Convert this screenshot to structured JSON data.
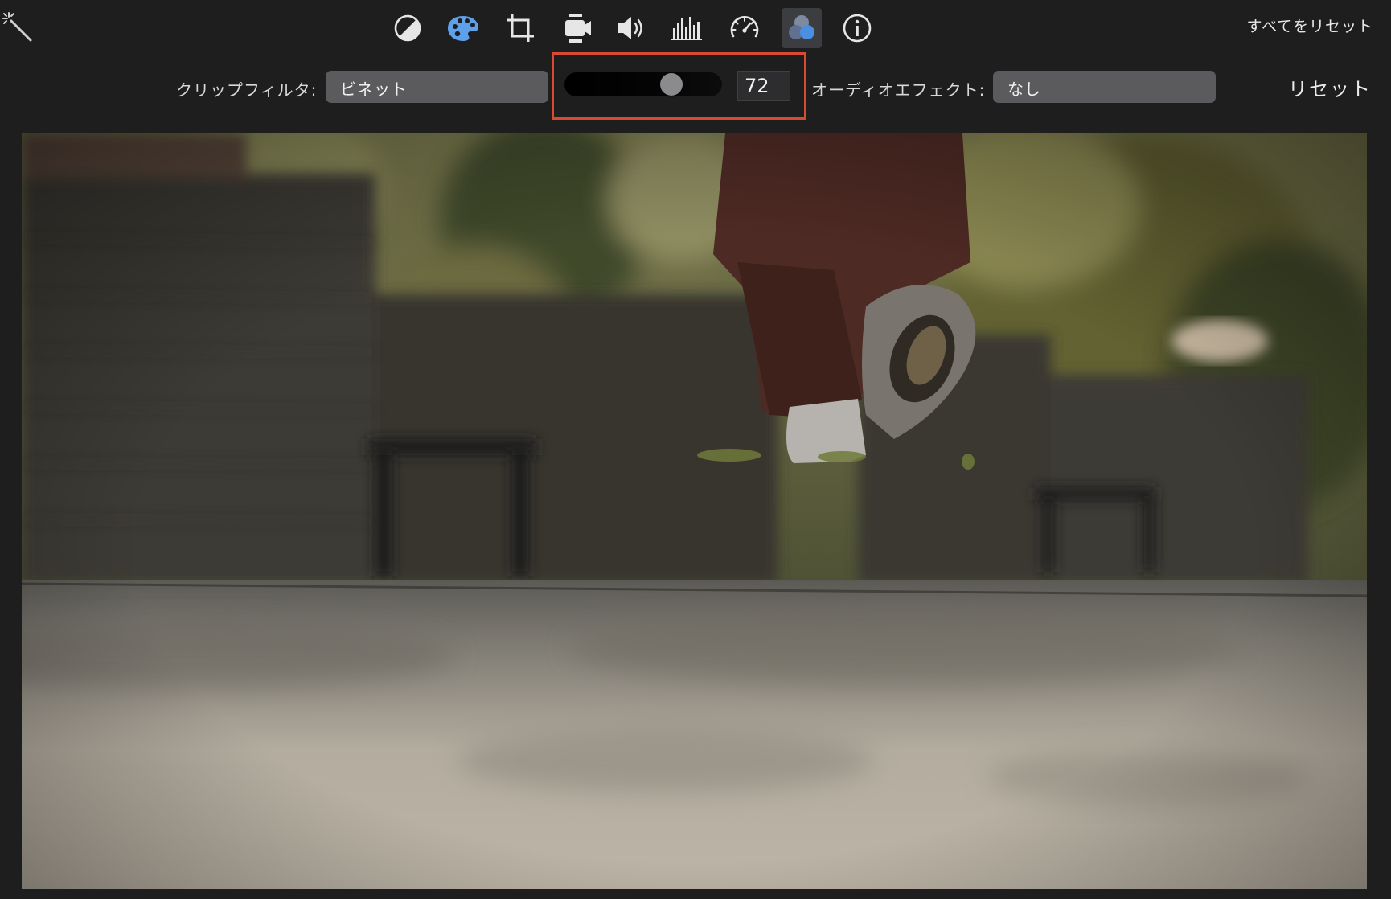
{
  "toolbar": {
    "reset_all_label": "すべてをリセット",
    "tools": [
      {
        "icon": "color-balance-icon"
      },
      {
        "icon": "color-palette-icon"
      },
      {
        "icon": "crop-icon"
      },
      {
        "icon": "stabilization-icon"
      },
      {
        "icon": "volume-icon"
      },
      {
        "icon": "equalizer-icon"
      },
      {
        "icon": "speed-icon"
      },
      {
        "icon": "clip-filter-icon",
        "active": true
      },
      {
        "icon": "info-icon"
      }
    ]
  },
  "filters": {
    "clip_filter_label": "クリップフィルタ:",
    "clip_filter_value": "ビネット",
    "intensity_value": "72",
    "intensity_fraction": 0.72,
    "audio_effect_label": "オーディオエフェクト:",
    "audio_effect_value": "なし",
    "reset_label": "リセット"
  },
  "colors": {
    "background": "#1e1e1f",
    "highlight_border": "#d94a33",
    "active_tool_bg": "#3c3d40",
    "accent_blue": "#4a8fe0"
  }
}
